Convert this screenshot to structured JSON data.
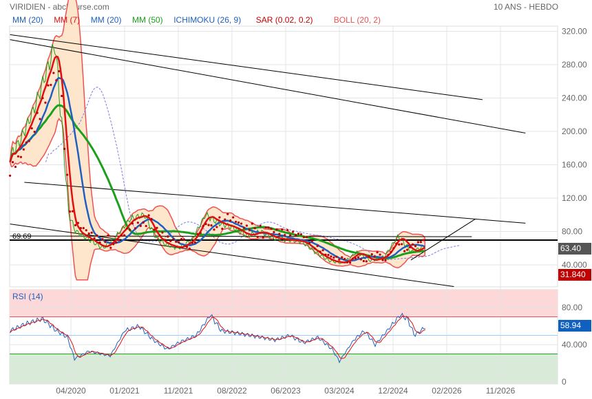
{
  "header": {
    "title": "VIRIDIEN - abcbourse.com",
    "period": "10 ANS - HEBDO"
  },
  "legend": [
    {
      "label": "MM (20)",
      "color": "#1f5fbf"
    },
    {
      "label": "MM (7)",
      "color": "#e01010"
    },
    {
      "label": "MM (20)",
      "color": "#1f5fbf"
    },
    {
      "label": "MM (50)",
      "color": "#1aa01a"
    },
    {
      "label": "ICHIMOKU (26, 9)",
      "color": "#1f5fbf"
    },
    {
      "label": "SAR (0.02, 0.2)",
      "color": "#c00000"
    },
    {
      "label": "BOLL (20, 2)",
      "color": "#f05050"
    }
  ],
  "tags": {
    "last_price": "63.40",
    "sar": "31.840",
    "rsi": "58.94",
    "hline": "69.69"
  },
  "rsi_label": "RSI (14)",
  "chart_data": [
    {
      "type": "line",
      "title": "VIRIDIEN",
      "ylim": [
        20,
        340
      ],
      "yticks": [
        "320.00",
        "280.00",
        "240.00",
        "200.00",
        "160.00",
        "120.00",
        "80.00",
        "40.000"
      ],
      "ytick_values": [
        320,
        280,
        240,
        200,
        160,
        120,
        80,
        40
      ],
      "xticks": [
        "04/2020",
        "01/2021",
        "11/2021",
        "08/2022",
        "06/2023",
        "03/2024",
        "12/2024",
        "02/2026",
        "11/2026"
      ],
      "xtick_values": [
        2020.25,
        2021.0,
        2021.75,
        2022.5,
        2023.25,
        2024.0,
        2024.75,
        2025.5,
        2026.25
      ],
      "price": {
        "t": [
          2019.4,
          2019.55,
          2019.75,
          2019.94,
          2020.03,
          2020.13,
          2020.22,
          2020.32,
          2020.51,
          2020.7,
          2020.89,
          2021.08,
          2021.28,
          2021.42,
          2021.56,
          2021.75,
          2021.94,
          2022.13,
          2022.32,
          2022.51,
          2022.71,
          2022.9,
          2023.09,
          2023.28,
          2023.48,
          2023.67,
          2023.86,
          2024.05,
          2024.24,
          2024.44,
          2024.63,
          2024.82,
          2025.01,
          2025.2
        ],
        "v": [
          170,
          190,
          230,
          280,
          305,
          200,
          100,
          80,
          70,
          60,
          75,
          95,
          100,
          75,
          65,
          60,
          70,
          100,
          90,
          85,
          75,
          80,
          72,
          70,
          68,
          55,
          45,
          42,
          55,
          45,
          50,
          75,
          55,
          63.4
        ]
      },
      "hline": 69.69,
      "trendlines": [
        [
          [
            2019.4,
            316
          ],
          [
            2026.0,
            238
          ]
        ],
        [
          [
            2019.4,
            310
          ],
          [
            2026.6,
            198
          ]
        ],
        [
          [
            2019.6,
            139
          ],
          [
            2026.6,
            90
          ]
        ],
        [
          [
            2019.4,
            89
          ],
          [
            2025.6,
            14
          ]
        ],
        [
          [
            2019.4,
            74.6
          ],
          [
            2025.85,
            73.8
          ]
        ],
        [
          [
            2025.0,
            45.8
          ],
          [
            2025.9,
            95
          ]
        ]
      ],
      "last": 63.4,
      "sar_last": 31.84
    },
    {
      "type": "line",
      "title": "RSI (14)",
      "ylim": [
        0,
        100
      ],
      "yticks": [
        "80.00",
        "40.000",
        "0"
      ],
      "ytick_values": [
        80,
        40,
        0
      ],
      "levels": [
        70,
        50,
        30
      ],
      "rsi": {
        "t": [
          2019.4,
          2019.6,
          2019.85,
          2020.05,
          2020.2,
          2020.3,
          2020.5,
          2020.8,
          2021.0,
          2021.2,
          2021.4,
          2021.6,
          2021.75,
          2022.0,
          2022.2,
          2022.35,
          2022.6,
          2022.9,
          2023.1,
          2023.3,
          2023.5,
          2023.7,
          2023.9,
          2024.0,
          2024.2,
          2024.35,
          2024.5,
          2024.7,
          2024.85,
          2024.95,
          2025.05,
          2025.2
        ],
        "v": [
          55,
          62,
          68,
          55,
          48,
          25,
          33,
          28,
          55,
          60,
          45,
          35,
          42,
          50,
          72,
          55,
          52,
          48,
          45,
          50,
          42,
          48,
          35,
          22,
          45,
          55,
          40,
          58,
          72,
          68,
          50,
          58.94
        ]
      }
    }
  ]
}
